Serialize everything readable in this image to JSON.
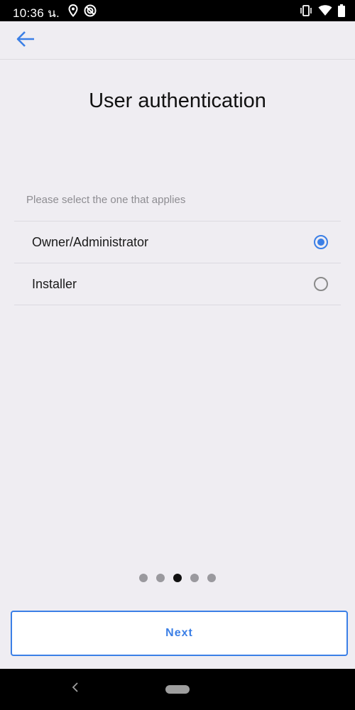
{
  "status_bar": {
    "time": "10:36 น.",
    "left_icons": [
      "location-icon",
      "do-not-disturb-icon"
    ],
    "right_icons": [
      "vibrate-icon",
      "wifi-icon",
      "battery-icon"
    ]
  },
  "app_bar": {
    "back_icon": "arrow-left-icon"
  },
  "page": {
    "title": "User authentication",
    "prompt": "Please select the one that applies"
  },
  "options": [
    {
      "label": "Owner/Administrator",
      "selected": true
    },
    {
      "label": "Installer",
      "selected": false
    }
  ],
  "pager": {
    "total": 5,
    "current": 3
  },
  "next_button": {
    "label": "Next"
  },
  "colors": {
    "accent": "#3b7fe6",
    "background": "#efedf2"
  }
}
